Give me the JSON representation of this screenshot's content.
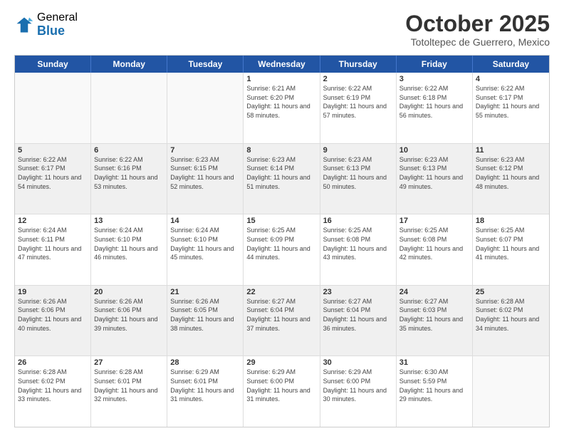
{
  "logo": {
    "general": "General",
    "blue": "Blue"
  },
  "title": "October 2025",
  "location": "Totoltepec de Guerrero, Mexico",
  "days": [
    "Sunday",
    "Monday",
    "Tuesday",
    "Wednesday",
    "Thursday",
    "Friday",
    "Saturday"
  ],
  "weeks": [
    [
      {
        "day": "",
        "sunrise": "",
        "sunset": "",
        "daylight": "",
        "empty": true
      },
      {
        "day": "",
        "sunrise": "",
        "sunset": "",
        "daylight": "",
        "empty": true
      },
      {
        "day": "",
        "sunrise": "",
        "sunset": "",
        "daylight": "",
        "empty": true
      },
      {
        "day": "1",
        "sunrise": "Sunrise: 6:21 AM",
        "sunset": "Sunset: 6:20 PM",
        "daylight": "Daylight: 11 hours and 58 minutes.",
        "empty": false
      },
      {
        "day": "2",
        "sunrise": "Sunrise: 6:22 AM",
        "sunset": "Sunset: 6:19 PM",
        "daylight": "Daylight: 11 hours and 57 minutes.",
        "empty": false
      },
      {
        "day": "3",
        "sunrise": "Sunrise: 6:22 AM",
        "sunset": "Sunset: 6:18 PM",
        "daylight": "Daylight: 11 hours and 56 minutes.",
        "empty": false
      },
      {
        "day": "4",
        "sunrise": "Sunrise: 6:22 AM",
        "sunset": "Sunset: 6:17 PM",
        "daylight": "Daylight: 11 hours and 55 minutes.",
        "empty": false
      }
    ],
    [
      {
        "day": "5",
        "sunrise": "Sunrise: 6:22 AM",
        "sunset": "Sunset: 6:17 PM",
        "daylight": "Daylight: 11 hours and 54 minutes.",
        "empty": false
      },
      {
        "day": "6",
        "sunrise": "Sunrise: 6:22 AM",
        "sunset": "Sunset: 6:16 PM",
        "daylight": "Daylight: 11 hours and 53 minutes.",
        "empty": false
      },
      {
        "day": "7",
        "sunrise": "Sunrise: 6:23 AM",
        "sunset": "Sunset: 6:15 PM",
        "daylight": "Daylight: 11 hours and 52 minutes.",
        "empty": false
      },
      {
        "day": "8",
        "sunrise": "Sunrise: 6:23 AM",
        "sunset": "Sunset: 6:14 PM",
        "daylight": "Daylight: 11 hours and 51 minutes.",
        "empty": false
      },
      {
        "day": "9",
        "sunrise": "Sunrise: 6:23 AM",
        "sunset": "Sunset: 6:13 PM",
        "daylight": "Daylight: 11 hours and 50 minutes.",
        "empty": false
      },
      {
        "day": "10",
        "sunrise": "Sunrise: 6:23 AM",
        "sunset": "Sunset: 6:13 PM",
        "daylight": "Daylight: 11 hours and 49 minutes.",
        "empty": false
      },
      {
        "day": "11",
        "sunrise": "Sunrise: 6:23 AM",
        "sunset": "Sunset: 6:12 PM",
        "daylight": "Daylight: 11 hours and 48 minutes.",
        "empty": false
      }
    ],
    [
      {
        "day": "12",
        "sunrise": "Sunrise: 6:24 AM",
        "sunset": "Sunset: 6:11 PM",
        "daylight": "Daylight: 11 hours and 47 minutes.",
        "empty": false
      },
      {
        "day": "13",
        "sunrise": "Sunrise: 6:24 AM",
        "sunset": "Sunset: 6:10 PM",
        "daylight": "Daylight: 11 hours and 46 minutes.",
        "empty": false
      },
      {
        "day": "14",
        "sunrise": "Sunrise: 6:24 AM",
        "sunset": "Sunset: 6:10 PM",
        "daylight": "Daylight: 11 hours and 45 minutes.",
        "empty": false
      },
      {
        "day": "15",
        "sunrise": "Sunrise: 6:25 AM",
        "sunset": "Sunset: 6:09 PM",
        "daylight": "Daylight: 11 hours and 44 minutes.",
        "empty": false
      },
      {
        "day": "16",
        "sunrise": "Sunrise: 6:25 AM",
        "sunset": "Sunset: 6:08 PM",
        "daylight": "Daylight: 11 hours and 43 minutes.",
        "empty": false
      },
      {
        "day": "17",
        "sunrise": "Sunrise: 6:25 AM",
        "sunset": "Sunset: 6:08 PM",
        "daylight": "Daylight: 11 hours and 42 minutes.",
        "empty": false
      },
      {
        "day": "18",
        "sunrise": "Sunrise: 6:25 AM",
        "sunset": "Sunset: 6:07 PM",
        "daylight": "Daylight: 11 hours and 41 minutes.",
        "empty": false
      }
    ],
    [
      {
        "day": "19",
        "sunrise": "Sunrise: 6:26 AM",
        "sunset": "Sunset: 6:06 PM",
        "daylight": "Daylight: 11 hours and 40 minutes.",
        "empty": false
      },
      {
        "day": "20",
        "sunrise": "Sunrise: 6:26 AM",
        "sunset": "Sunset: 6:06 PM",
        "daylight": "Daylight: 11 hours and 39 minutes.",
        "empty": false
      },
      {
        "day": "21",
        "sunrise": "Sunrise: 6:26 AM",
        "sunset": "Sunset: 6:05 PM",
        "daylight": "Daylight: 11 hours and 38 minutes.",
        "empty": false
      },
      {
        "day": "22",
        "sunrise": "Sunrise: 6:27 AM",
        "sunset": "Sunset: 6:04 PM",
        "daylight": "Daylight: 11 hours and 37 minutes.",
        "empty": false
      },
      {
        "day": "23",
        "sunrise": "Sunrise: 6:27 AM",
        "sunset": "Sunset: 6:04 PM",
        "daylight": "Daylight: 11 hours and 36 minutes.",
        "empty": false
      },
      {
        "day": "24",
        "sunrise": "Sunrise: 6:27 AM",
        "sunset": "Sunset: 6:03 PM",
        "daylight": "Daylight: 11 hours and 35 minutes.",
        "empty": false
      },
      {
        "day": "25",
        "sunrise": "Sunrise: 6:28 AM",
        "sunset": "Sunset: 6:02 PM",
        "daylight": "Daylight: 11 hours and 34 minutes.",
        "empty": false
      }
    ],
    [
      {
        "day": "26",
        "sunrise": "Sunrise: 6:28 AM",
        "sunset": "Sunset: 6:02 PM",
        "daylight": "Daylight: 11 hours and 33 minutes.",
        "empty": false
      },
      {
        "day": "27",
        "sunrise": "Sunrise: 6:28 AM",
        "sunset": "Sunset: 6:01 PM",
        "daylight": "Daylight: 11 hours and 32 minutes.",
        "empty": false
      },
      {
        "day": "28",
        "sunrise": "Sunrise: 6:29 AM",
        "sunset": "Sunset: 6:01 PM",
        "daylight": "Daylight: 11 hours and 31 minutes.",
        "empty": false
      },
      {
        "day": "29",
        "sunrise": "Sunrise: 6:29 AM",
        "sunset": "Sunset: 6:00 PM",
        "daylight": "Daylight: 11 hours and 31 minutes.",
        "empty": false
      },
      {
        "day": "30",
        "sunrise": "Sunrise: 6:29 AM",
        "sunset": "Sunset: 6:00 PM",
        "daylight": "Daylight: 11 hours and 30 minutes.",
        "empty": false
      },
      {
        "day": "31",
        "sunrise": "Sunrise: 6:30 AM",
        "sunset": "Sunset: 5:59 PM",
        "daylight": "Daylight: 11 hours and 29 minutes.",
        "empty": false
      },
      {
        "day": "",
        "sunrise": "",
        "sunset": "",
        "daylight": "",
        "empty": true
      }
    ]
  ]
}
